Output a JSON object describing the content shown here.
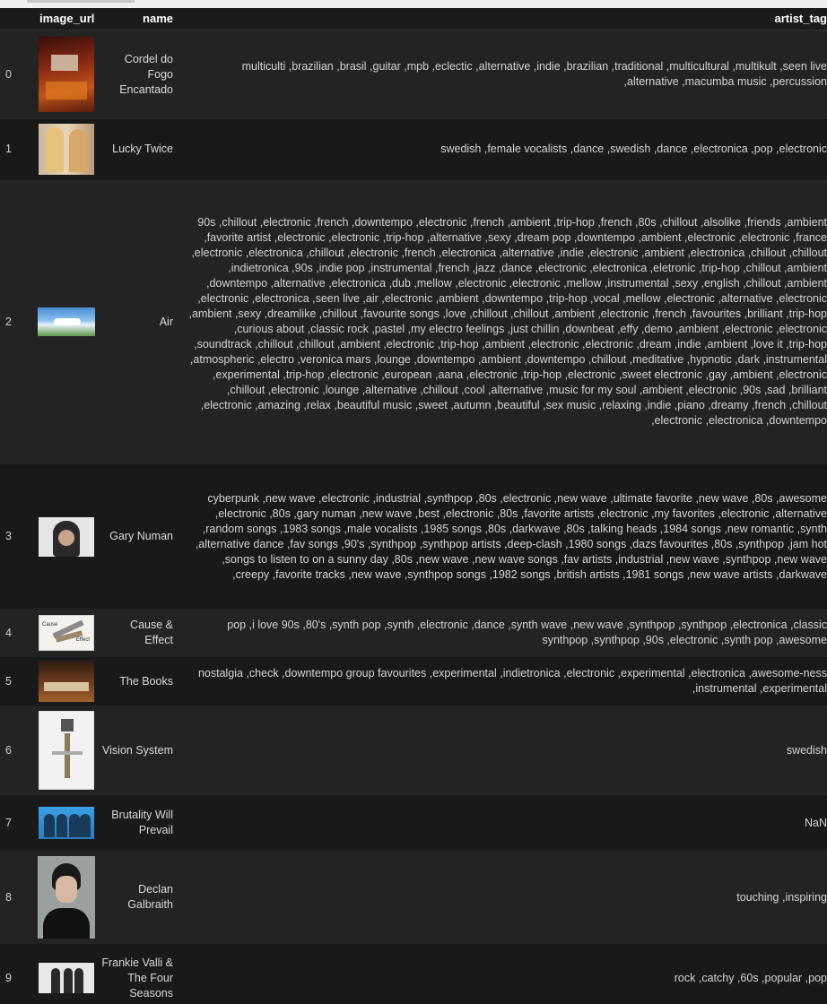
{
  "columns": {
    "url": "image_url",
    "name": "name",
    "tags": "artist_tag"
  },
  "rows": [
    {
      "index": "0",
      "name": "Cordel do Fogo Encantado",
      "tags": "multiculti ,brazilian ,brasil ,guitar ,mpb ,eclectic ,alternative ,indie ,brazilian ,traditional ,multicultural ,multikult ,seen live ,alternative ,macumba music ,percussion"
    },
    {
      "index": "1",
      "name": "Lucky Twice",
      "tags": "swedish ,female vocalists ,dance ,swedish ,dance ,electronica ,pop ,electronic"
    },
    {
      "index": "2",
      "name": "Air",
      "tags": "90s ,chillout ,electronic ,french ,downtempo ,electronic ,french ,ambient ,trip-hop ,french ,80s ,chillout ,alsolike ,friends ,ambient ,favorite artist ,electronic ,electronic ,trip-hop ,alternative ,sexy ,dream pop ,downtempo ,ambient ,electronic ,electronic ,france ,electronic ,electronica ,chillout ,electronic ,french ,electronica ,alternative ,indie ,electronic ,ambient ,electronica ,chillout ,chillout ,indietronica ,90s ,indie pop ,instrumental ,french ,jazz ,dance ,electronic ,electronica ,eletronic ,trip-hop ,chillout ,ambient ,downtempo ,alternative ,electronica ,dub ,mellow ,electronic ,electronic ,mellow ,instrumental ,sexy ,english ,chillout ,ambient ,electronic ,electronica ,seen live ,air ,electronic ,ambient ,downtempo ,trip-hop ,vocal ,mellow ,electronic ,alternative ,electronic ,ambient ,sexy ,dreamlike ,chillout ,favourite songs ,love ,chillout ,chillout ,ambient ,electronic ,french ,favourites ,brilliant ,trip-hop ,curious about ,classic rock ,pastel ,my electro feelings ,just chillin ,downbeat ,effy ,demo ,ambient ,electronic ,electronic ,soundtrack ,chillout ,chillout ,ambient ,electronic ,trip-hop ,ambient ,electronic ,electronic ,dream ,indie ,ambient ,love it ,trip-hop ,atmospheric ,electro ,veronica mars ,lounge ,downtempo ,ambient ,downtempo ,chillout ,meditative ,hypnotic ,dark ,instrumental ,experimental ,trip-hop ,electronic ,european ,aana ,electronic ,trip-hop ,electronic ,sweet electronic ,gay ,ambient ,electronic ,chillout ,electronic ,lounge ,alternative ,chillout ,cool ,alternative ,music for my soul ,ambient ,electronic ,90s ,sad ,brilliant ,electronic ,amazing ,relax ,beautiful music ,sweet ,autumn ,beautiful ,sex music ,relaxing ,indie ,piano ,dreamy ,french ,chillout ,electronic ,electronica ,downtempo"
    },
    {
      "index": "3",
      "name": "Gary Numan",
      "tags": "cyberpunk ,new wave ,electronic ,industrial ,synthpop ,80s ,electronic ,new wave ,ultimate favorite ,new wave ,80s ,awesome ,electronic ,80s ,gary numan ,new wave ,best ,electronic ,80s ,favorite artists ,electronic ,my favorites ,electronic ,alternative ,random songs ,1983 songs ,male vocalists ,1985 songs ,80s ,darkwave ,80s ,talking heads ,1984 songs ,new romantic ,synth ,alternative dance ,fav songs ,90's ,synthpop ,synthpop artists ,deep-clash ,1980 songs ,dazs favourites ,80s ,synthpop ,jam hot ,songs to listen to on a sunny day ,80s ,new wave ,new wave songs ,fav artists ,industrial ,new wave ,synthpop ,new wave ,creepy ,favorite tracks ,new wave ,synthpop songs ,1982 songs ,british artists ,1981 songs ,new wave artists ,darkwave"
    },
    {
      "index": "4",
      "name": "Cause & Effect",
      "tags": "pop ,i love 90s ,80's ,synth pop ,synth ,electronic ,dance ,synth wave ,new wave ,synthpop ,synthpop ,electronica ,classic synthpop ,synthpop ,90s ,electronic ,synth pop ,awesome"
    },
    {
      "index": "5",
      "name": "The Books",
      "tags": "nostalgia ,check ,downtempo group favourites ,experimental ,indietronica ,electronic ,experimental ,electronica ,awesome-ness ,instrumental ,experimental"
    },
    {
      "index": "6",
      "name": "Vision System",
      "tags": "swedish"
    },
    {
      "index": "7",
      "name": "Brutality Will Prevail",
      "tags": "NaN"
    },
    {
      "index": "8",
      "name": "Declan Galbraith",
      "tags": "touching ,inspiring"
    },
    {
      "index": "9",
      "name": "Frankie Valli & The Four Seasons",
      "tags": "rock ,catchy ,60s ,popular ,pop"
    }
  ],
  "thumbnails": [
    "album-cover-art",
    "duo-photo",
    "landscape-photo",
    "portrait-photo",
    "logo-graphic",
    "books-photo",
    "sculpture-photo",
    "band-photo",
    "portrait-photo",
    "group-photo"
  ]
}
